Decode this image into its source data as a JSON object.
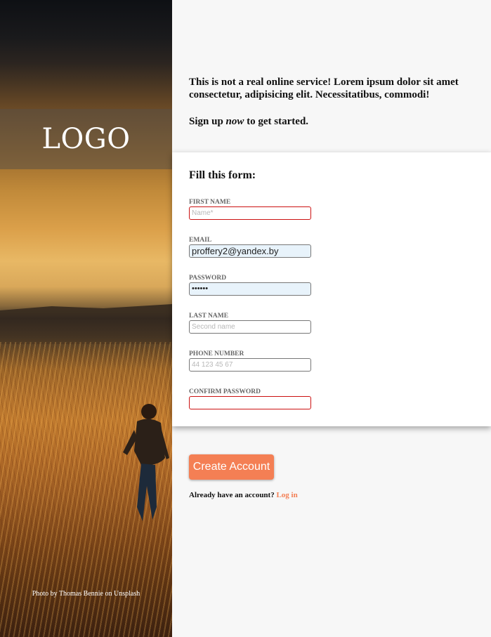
{
  "brand": {
    "logo_text": "LOGO"
  },
  "photo": {
    "credit": "Photo by Thomas Bennie on Unsplash"
  },
  "intro": {
    "line": "This is not a real online service! Lorem ipsum dolor sit amet consectetur, adipisicing elit. Necessitatibus, commodi!",
    "signup_before": "Sign up ",
    "signup_em": "now",
    "signup_after": " to get started."
  },
  "form": {
    "title": "Fill this form:",
    "fields": [
      {
        "label": "First name",
        "value": "",
        "placeholder": "Name*",
        "state": "error"
      },
      {
        "label": "Email",
        "value": "proffery2@yandex.by",
        "placeholder": "",
        "state": "autofilled"
      },
      {
        "label": "Password",
        "value": "••••••",
        "placeholder": "",
        "state": "autofilled"
      },
      {
        "label": "Last name",
        "value": "",
        "placeholder": "Second name",
        "state": "normal"
      },
      {
        "label": "Phone number",
        "value": "",
        "placeholder": "44 123 45 67",
        "state": "normal"
      },
      {
        "label": "Confirm password",
        "value": "",
        "placeholder": "",
        "state": "error"
      }
    ]
  },
  "actions": {
    "create_label": "Create Account",
    "login_prompt": "Already have an account?",
    "login_link": "Log in"
  },
  "colors": {
    "accent": "#f47f54",
    "error_border": "#cc1111",
    "autofill_bg": "#e8f3fb"
  }
}
